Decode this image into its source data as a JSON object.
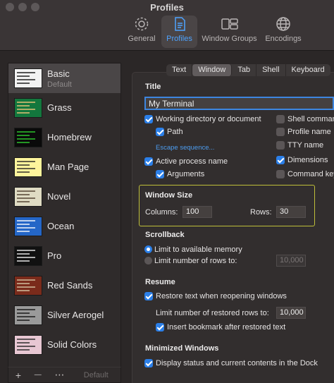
{
  "window": {
    "title": "Profiles"
  },
  "toolbar": [
    {
      "label": "General",
      "icon": "gear-icon"
    },
    {
      "label": "Profiles",
      "icon": "profiles-icon"
    },
    {
      "label": "Window Groups",
      "icon": "window-groups-icon"
    },
    {
      "label": "Encodings",
      "icon": "globe-icon"
    }
  ],
  "profiles": [
    {
      "name": "Basic",
      "sub": "Default",
      "bg": "#f2f2f2",
      "fg": "#111"
    },
    {
      "name": "Grass",
      "bg": "#13773d",
      "fg": "#f3c67a"
    },
    {
      "name": "Homebrew",
      "bg": "#0a0a0a",
      "fg": "#2ed12e"
    },
    {
      "name": "Man Page",
      "bg": "#fef49c",
      "fg": "#222"
    },
    {
      "name": "Novel",
      "bg": "#dfdbc3",
      "fg": "#4a3a2a"
    },
    {
      "name": "Ocean",
      "bg": "#2466c7",
      "fg": "#fff"
    },
    {
      "name": "Pro",
      "bg": "#111",
      "fg": "#f2f2f2"
    },
    {
      "name": "Red Sands",
      "bg": "#7a2b1b",
      "fg": "#d7c9a7"
    },
    {
      "name": "Silver Aerogel",
      "bg": "#9a9a9a",
      "fg": "#111"
    },
    {
      "name": "Solid Colors",
      "bg": "#e8c7d3",
      "fg": "#222"
    }
  ],
  "sidebar_footer": {
    "add": "+",
    "remove": "—",
    "more": "⋯",
    "default": "Default"
  },
  "tabs": [
    "Text",
    "Window",
    "Tab",
    "Shell",
    "Keyboard"
  ],
  "active_tab": "Window",
  "title_section": {
    "heading": "Title",
    "value": "My Terminal",
    "left_options": [
      {
        "label": "Working directory or document",
        "checked": true
      },
      {
        "label": "Path",
        "checked": true
      },
      {
        "label": "Active process name",
        "checked": true
      },
      {
        "label": "Arguments",
        "checked": true
      }
    ],
    "escape_link": "Escape sequence...",
    "right_options": [
      {
        "label": "Shell comman",
        "checked": false
      },
      {
        "label": "Profile name",
        "checked": false
      },
      {
        "label": "TTY name",
        "checked": false
      },
      {
        "label": "Dimensions",
        "checked": true
      },
      {
        "label": "Command key",
        "checked": false
      }
    ]
  },
  "window_size": {
    "heading": "Window Size",
    "columns_label": "Columns:",
    "columns": "100",
    "rows_label": "Rows:",
    "rows": "30"
  },
  "scrollback": {
    "heading": "Scrollback",
    "opt1": "Limit to available memory",
    "opt2": "Limit number of rows to:",
    "rows_value": "10,000",
    "selected": 1
  },
  "resume": {
    "heading": "Resume",
    "restore": "Restore text when reopening windows",
    "limit_label": "Limit number of restored rows to:",
    "limit_value": "10,000",
    "bookmark": "Insert bookmark after restored text"
  },
  "minimized": {
    "heading": "Minimized Windows",
    "display": "Display status and current contents in the Dock"
  }
}
